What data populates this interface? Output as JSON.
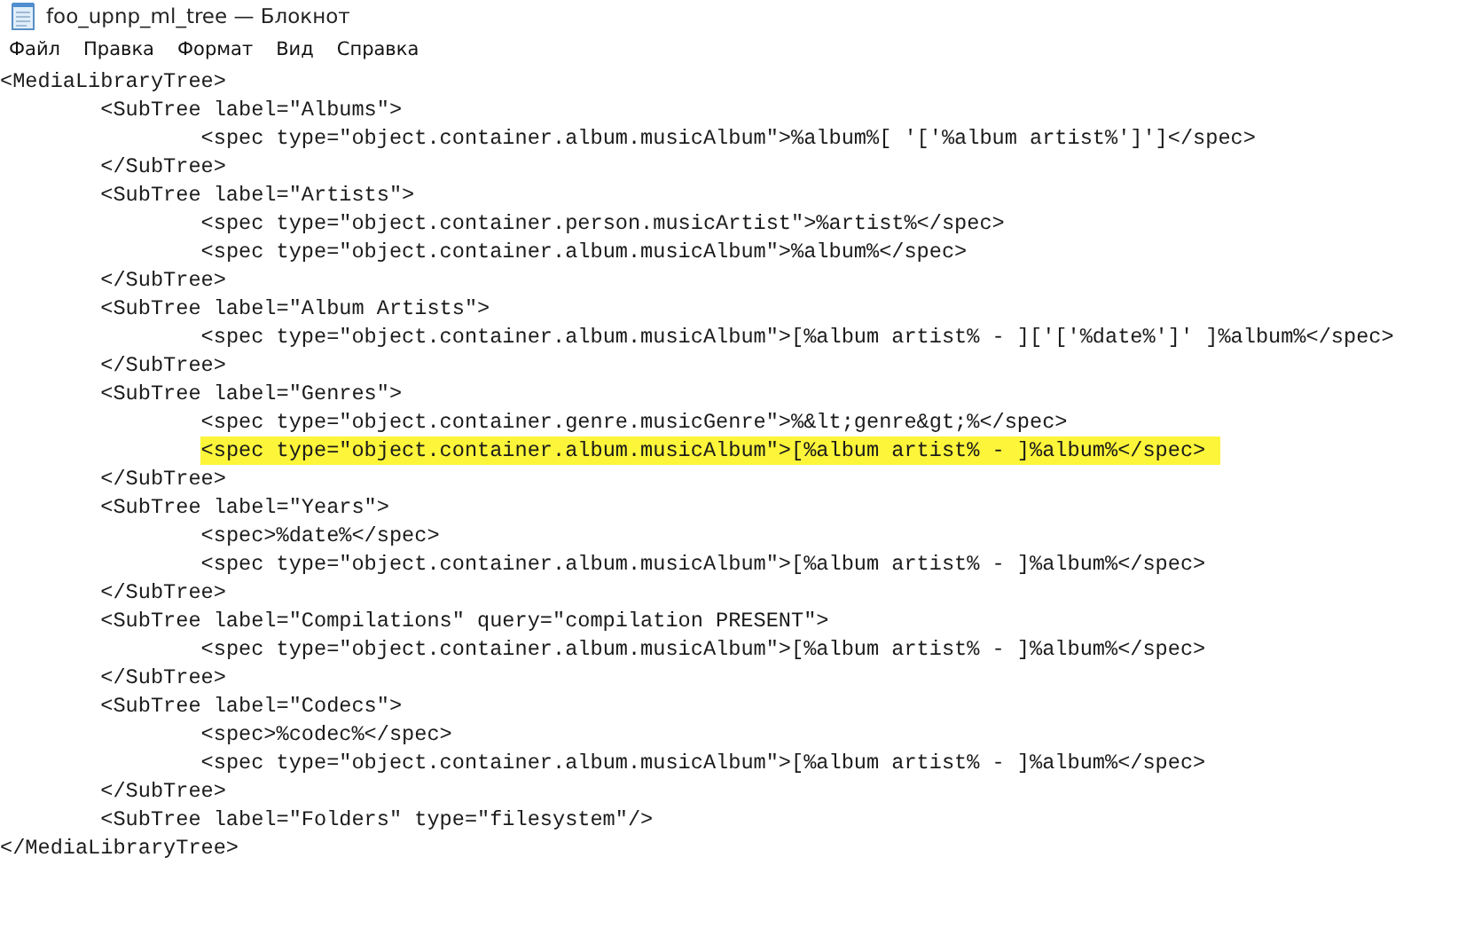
{
  "window": {
    "title": "foo_upnp_ml_tree — Блокнот"
  },
  "menu": [
    "Файл",
    "Правка",
    "Формат",
    "Вид",
    "Справка"
  ],
  "lines": [
    {
      "text": "<MediaLibraryTree>",
      "highlighted": false
    },
    {
      "text": "\t<SubTree label=\"Albums\">",
      "highlighted": false
    },
    {
      "text": "\t\t<spec type=\"object.container.album.musicAlbum\">%album%[ '['%album artist%']']</spec>",
      "highlighted": false
    },
    {
      "text": "\t</SubTree>",
      "highlighted": false
    },
    {
      "text": "\t<SubTree label=\"Artists\">",
      "highlighted": false
    },
    {
      "text": "\t\t<spec type=\"object.container.person.musicArtist\">%artist%</spec>",
      "highlighted": false
    },
    {
      "text": "\t\t<spec type=\"object.container.album.musicAlbum\">%album%</spec>",
      "highlighted": false
    },
    {
      "text": "\t</SubTree>",
      "highlighted": false
    },
    {
      "text": "\t<SubTree label=\"Album Artists\">",
      "highlighted": false
    },
    {
      "text": "\t\t<spec type=\"object.container.album.musicAlbum\">[%album artist% - ]['['%date%']' ]%album%</spec>",
      "highlighted": false
    },
    {
      "text": "\t</SubTree>",
      "highlighted": false
    },
    {
      "text": "\t<SubTree label=\"Genres\">",
      "highlighted": false
    },
    {
      "text": "\t\t<spec type=\"object.container.genre.musicGenre\">%&lt;genre&gt;%</spec>",
      "highlighted": false
    },
    {
      "text": "\t\t<spec type=\"object.container.album.musicAlbum\">[%album artist% - ]%album%</spec>",
      "highlighted": true
    },
    {
      "text": "\t</SubTree>",
      "highlighted": false
    },
    {
      "text": "\t<SubTree label=\"Years\">",
      "highlighted": false
    },
    {
      "text": "\t\t<spec>%date%</spec>",
      "highlighted": false
    },
    {
      "text": "\t\t<spec type=\"object.container.album.musicAlbum\">[%album artist% - ]%album%</spec>",
      "highlighted": false
    },
    {
      "text": "\t</SubTree>",
      "highlighted": false
    },
    {
      "text": "\t<SubTree label=\"Compilations\" query=\"compilation PRESENT\">",
      "highlighted": false
    },
    {
      "text": "\t\t<spec type=\"object.container.album.musicAlbum\">[%album artist% - ]%album%</spec>",
      "highlighted": false
    },
    {
      "text": "\t</SubTree>",
      "highlighted": false
    },
    {
      "text": "\t<SubTree label=\"Codecs\">",
      "highlighted": false
    },
    {
      "text": "\t\t<spec>%codec%</spec>",
      "highlighted": false
    },
    {
      "text": "\t\t<spec type=\"object.container.album.musicAlbum\">[%album artist% - ]%album%</spec>",
      "highlighted": false
    },
    {
      "text": "\t</SubTree>",
      "highlighted": false
    },
    {
      "text": "\t<SubTree label=\"Folders\" type=\"filesystem\"/>",
      "highlighted": false
    },
    {
      "text": "</MediaLibraryTree>",
      "highlighted": false
    }
  ]
}
